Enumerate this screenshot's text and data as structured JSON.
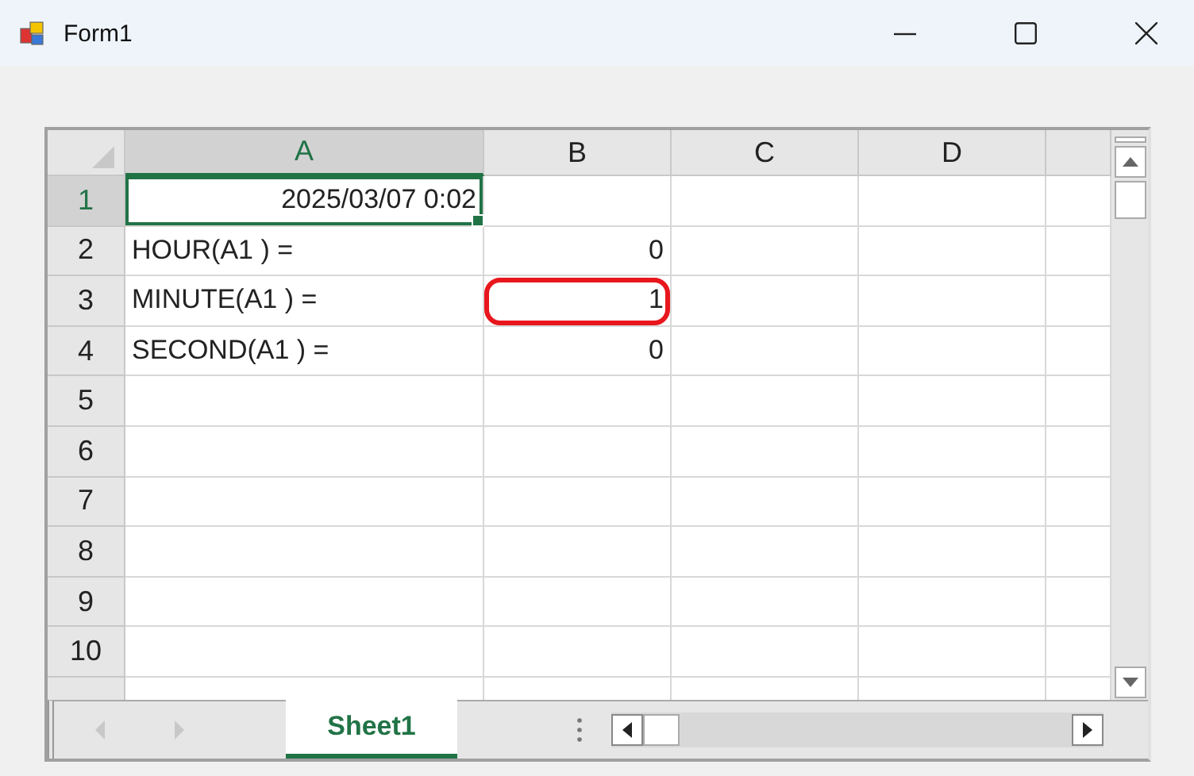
{
  "window": {
    "title": "Form1"
  },
  "columns": [
    {
      "label": "A",
      "selected": true
    },
    {
      "label": "B",
      "selected": false
    },
    {
      "label": "C",
      "selected": false
    },
    {
      "label": "D",
      "selected": false
    }
  ],
  "rows": [
    {
      "label": "1",
      "selected": true,
      "cells": {
        "A": {
          "text": "2025/03/07 0:02",
          "kind": "number",
          "active": true,
          "circled": false
        }
      }
    },
    {
      "label": "2",
      "selected": false,
      "cells": {
        "A": {
          "text": "HOUR(A1 ) =",
          "kind": "text",
          "active": false,
          "circled": false
        },
        "B": {
          "text": "0",
          "kind": "number",
          "active": false,
          "circled": false
        }
      }
    },
    {
      "label": "3",
      "selected": false,
      "cells": {
        "A": {
          "text": "MINUTE(A1 ) =",
          "kind": "text",
          "active": false,
          "circled": false
        },
        "B": {
          "text": "1",
          "kind": "number",
          "active": false,
          "circled": true
        }
      }
    },
    {
      "label": "4",
      "selected": false,
      "cells": {
        "A": {
          "text": "SECOND(A1 ) =",
          "kind": "text",
          "active": false,
          "circled": false
        },
        "B": {
          "text": "0",
          "kind": "number",
          "active": false,
          "circled": false
        }
      }
    },
    {
      "label": "5",
      "selected": false
    },
    {
      "label": "6",
      "selected": false
    },
    {
      "label": "7",
      "selected": false
    },
    {
      "label": "8",
      "selected": false
    },
    {
      "label": "9",
      "selected": false
    },
    {
      "label": "10",
      "selected": false
    }
  ],
  "sheet_tabs": [
    {
      "label": "Sheet1",
      "selected": true
    }
  ]
}
